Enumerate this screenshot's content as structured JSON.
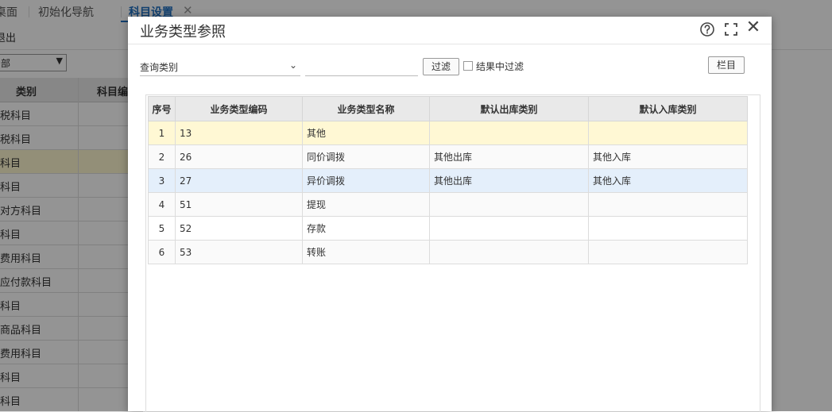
{
  "app": {
    "tabs": [
      "桌面",
      "初始化导航",
      "科目设置"
    ],
    "exit_label": "退出",
    "filter_value": "部",
    "grid_headers": [
      "类别",
      "科目编"
    ],
    "rows": [
      "税科目",
      "税科目",
      "科目",
      "科目",
      "对方科目",
      "科目",
      "费用科目",
      "应付款科目",
      "科目",
      "商品科目",
      "费用科目",
      "科目",
      "科目"
    ]
  },
  "dialog": {
    "title": "业务类型参照",
    "query_select_value": "查询类别",
    "query_input_value": "",
    "filter_button": "过滤",
    "filter_in_results_label": "结果中过滤",
    "filter_in_results_checked": false,
    "columns_button": "栏目",
    "table": {
      "headers": [
        "序号",
        "业务类型编码",
        "业务类型名称",
        "默认出库类别",
        "默认入库类别"
      ],
      "rows": [
        [
          "1",
          "13",
          "其他",
          "",
          ""
        ],
        [
          "2",
          "26",
          "同价调拨",
          "其他出库",
          "其他入库"
        ],
        [
          "3",
          "27",
          "异价调拨",
          "其他出库",
          "其他入库"
        ],
        [
          "4",
          "51",
          "提现",
          "",
          ""
        ],
        [
          "5",
          "52",
          "存款",
          "",
          ""
        ],
        [
          "6",
          "53",
          "转账",
          "",
          ""
        ]
      ]
    }
  }
}
